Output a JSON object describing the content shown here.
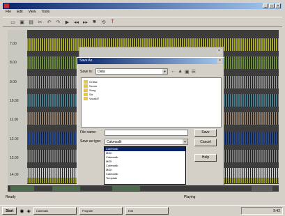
{
  "menu": [
    "File",
    "Edit",
    "View",
    "Tools"
  ],
  "toolbar_icons": [
    "new-icon",
    "save-icon",
    "open-icon",
    "cut-icon",
    "undo-icon",
    "redo-icon",
    "play-icon",
    "rewind-icon",
    "forward-icon",
    "stop-icon",
    "loop-icon",
    "tools-icon"
  ],
  "ruler_ticks": [
    "7.00",
    "8.00",
    "9.00",
    "10.00",
    "11.00",
    "12.00",
    "13.00",
    "14.00",
    "15.00"
  ],
  "dialog": {
    "title": "Save As",
    "look_in_label": "Save in:",
    "look_in_value": "Data",
    "files": [
      "OrStar",
      "Scene",
      "Song",
      "Str",
      "VocaNT"
    ],
    "filename_label": "File name:",
    "filename_value": "",
    "savetype_label": "Save as type:",
    "savetype_value": "Cakewalk",
    "save_button": "Save",
    "cancel_button": "Cancel",
    "help_button": "Help",
    "type_options": [
      "Cakewalk",
      "MIDI",
      "Cakewalk",
      "MIDI",
      "Cakewalk",
      "MIDI",
      "Cakewalk",
      "Template"
    ]
  },
  "statusbar_left": "Ready",
  "statusbar_mid": "Playing",
  "taskbar": {
    "start": "Start",
    "tasks": [
      "Cakewalk",
      "Program",
      "Edit"
    ],
    "time": "9:42"
  }
}
